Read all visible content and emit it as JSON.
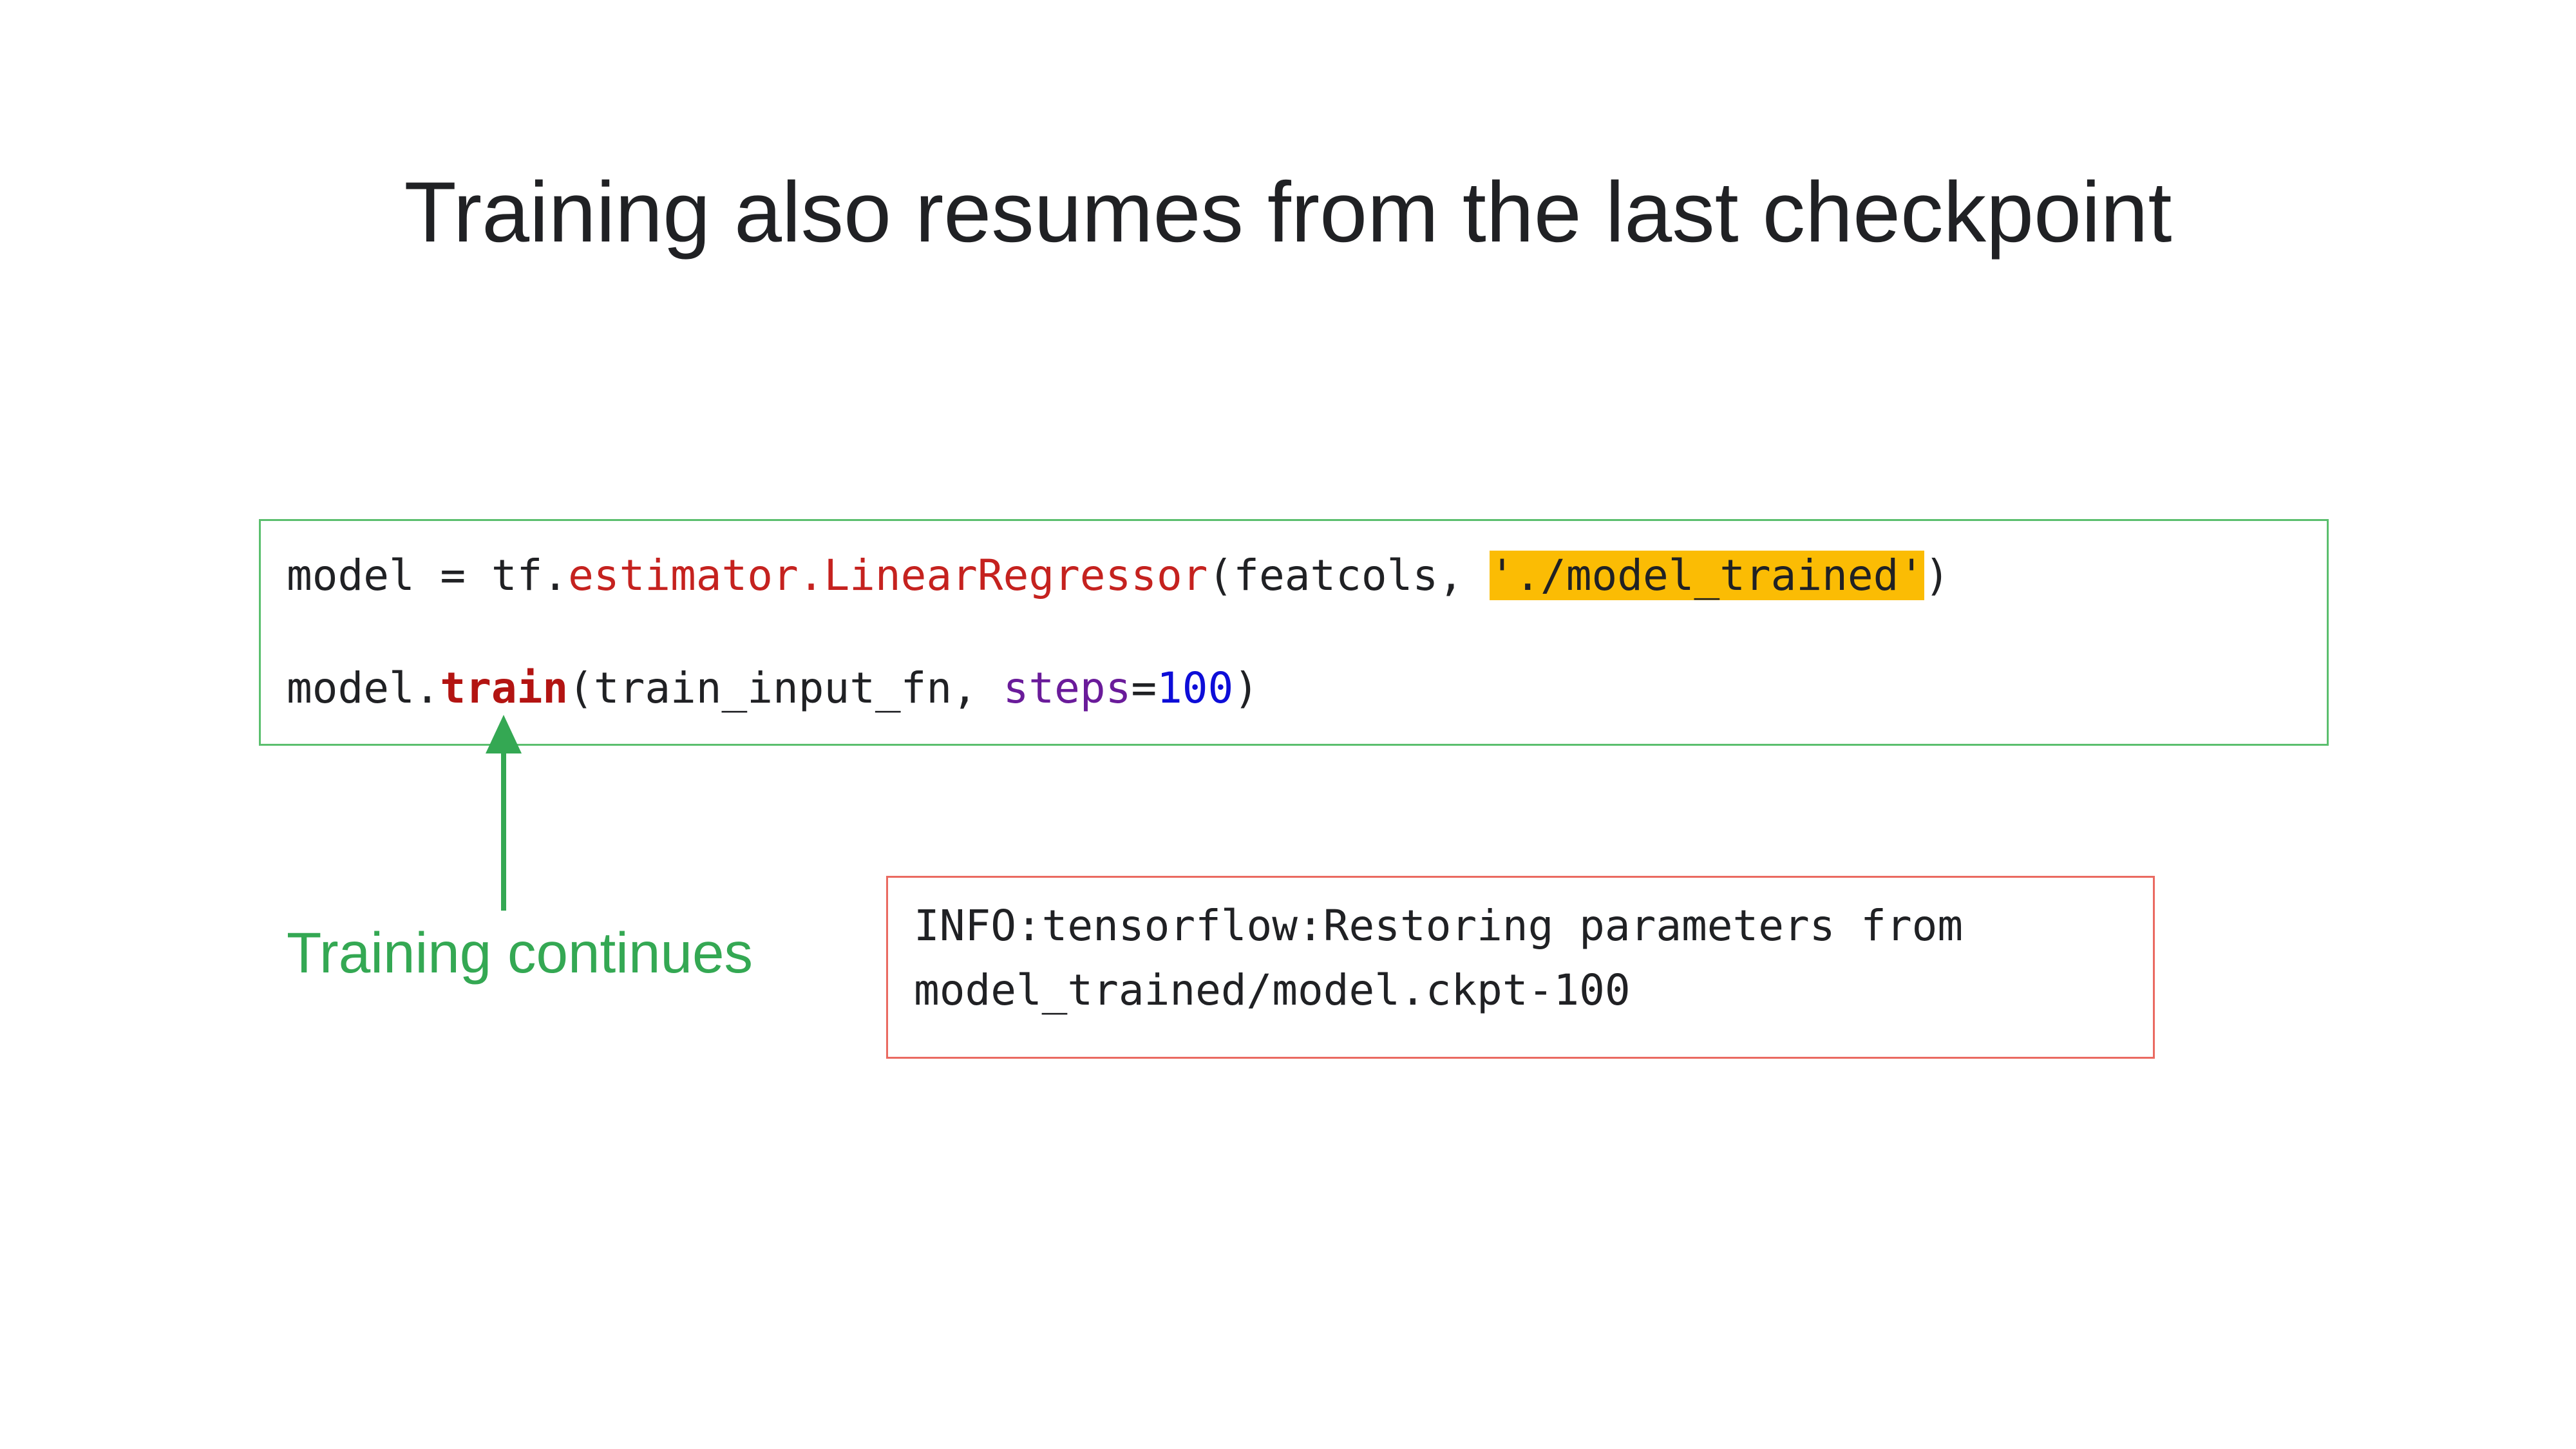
{
  "slide": {
    "title": "Training also resumes from the last checkpoint"
  },
  "code": {
    "line1": {
      "prefix": "model = tf.",
      "call": "estimator.LinearRegressor",
      "args_open": "(featcols, ",
      "path_arg": "'./model_trained'",
      "args_close": ")"
    },
    "line2": {
      "prefix": "model.",
      "method": "train",
      "args_open": "(train_input_fn, ",
      "kwarg_name": "steps",
      "equals": "=",
      "kwarg_value": "100",
      "args_close": ")"
    }
  },
  "annotation": {
    "label": "Training continues",
    "arrow_icon": "up-arrow-icon"
  },
  "log": {
    "line1": "INFO:tensorflow:Restoring parameters from",
    "line2": "model_trained/model.ckpt-100"
  },
  "colors": {
    "code_box_border": "#5bbf6e",
    "log_box_border": "#ea6a61",
    "highlight": "#fbbc04",
    "accent_green": "#34a853",
    "keyword_red": "#c5221f",
    "param_purple": "#6a1b9a",
    "number_blue": "#0d0dd8"
  }
}
